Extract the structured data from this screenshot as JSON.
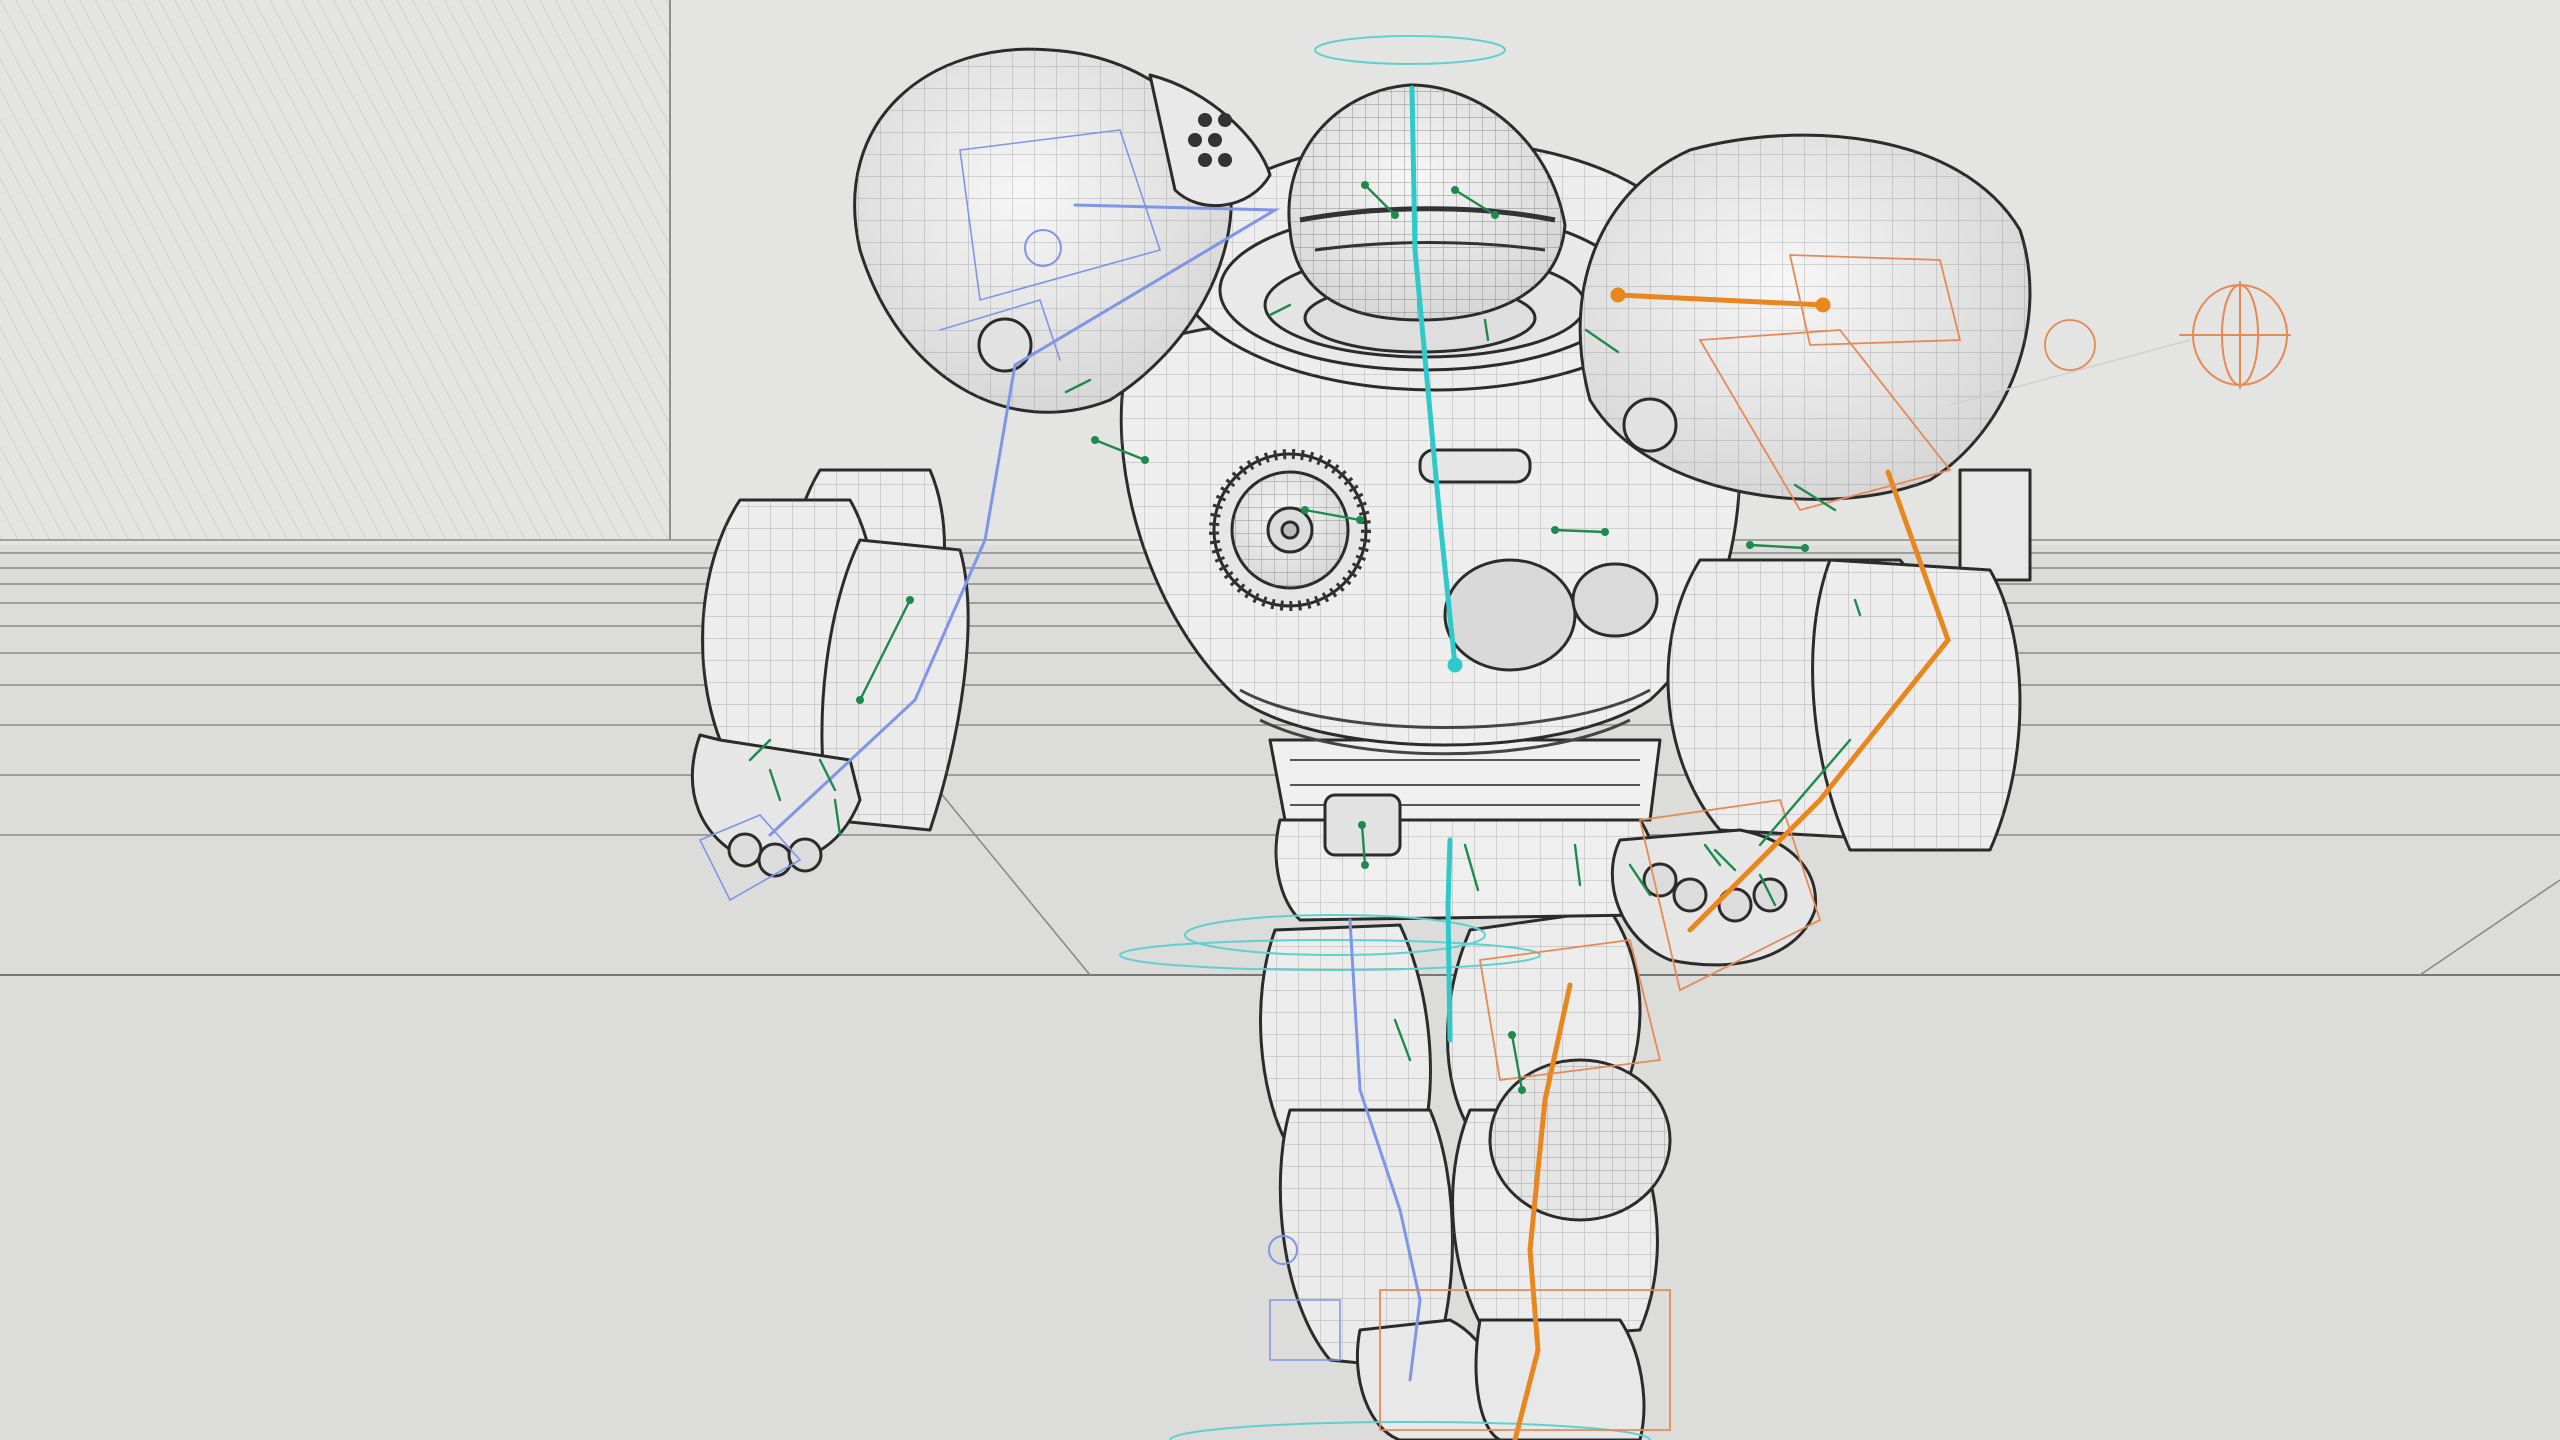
{
  "viewport": {
    "kind": "3d-viewport",
    "display_mode": "wireframe-on-shaded",
    "subject": "armored-mech-character-rig"
  },
  "colors": {
    "background": "#dcdcdb",
    "back_wall": "#e3e3e2",
    "hatch": "#bdbdbc",
    "floor_line": "#8e8e8e",
    "mesh_fill": "#eeeeee",
    "mesh_stroke": "#2b2b2b",
    "wire_grid": "#7a7a7a",
    "spine_bone": "#2ec9c9",
    "left_arm_ik": "#7f95e8",
    "right_limb_bone": "#e9861e",
    "right_limb_ctrl": "#e58a55",
    "joint_helper": "#1f8a4c",
    "root_ring": "#5fd0d0"
  },
  "icons": [
    "spine-bone-chain-icon",
    "right-arm-bone-chain-icon",
    "right-leg-bone-chain-icon",
    "left-arm-ik-chain-icon",
    "look-at-control-icon",
    "root-control-ring-icon"
  ]
}
